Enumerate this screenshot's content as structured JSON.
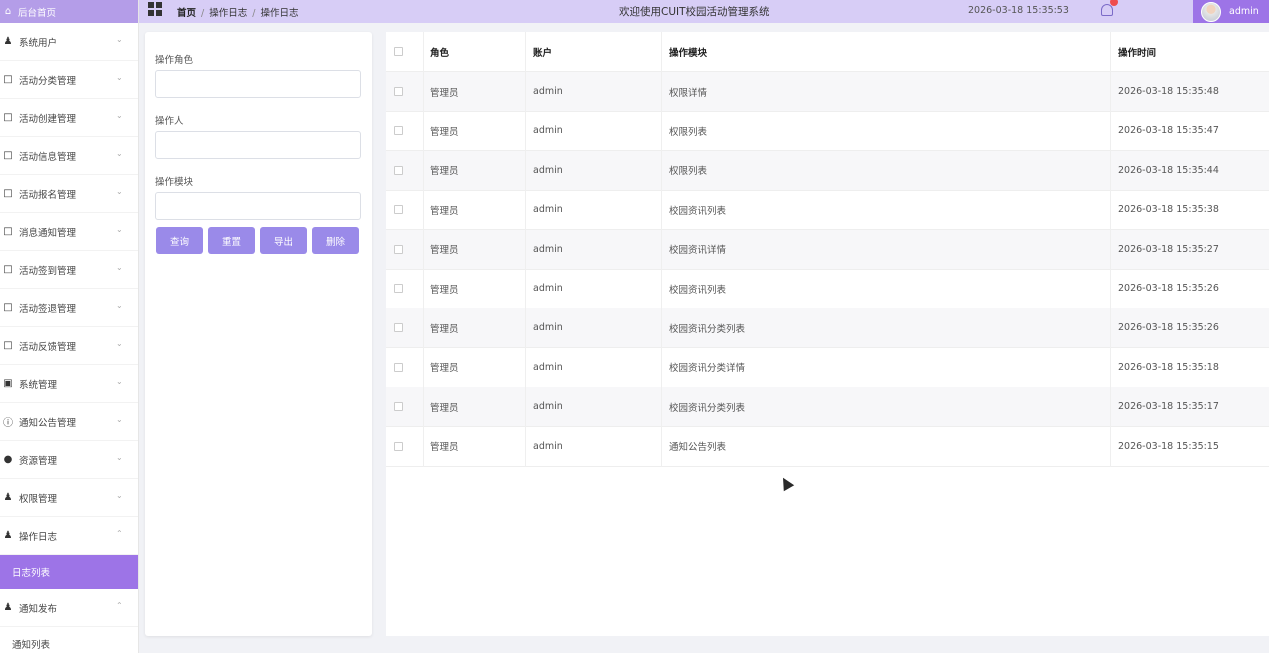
{
  "sidebar": {
    "home_label": "后台首页",
    "items": [
      {
        "label": "系统用户",
        "icon": "user-icon",
        "expanded": false
      },
      {
        "label": "活动分类管理",
        "icon": "tag-icon",
        "expanded": false
      },
      {
        "label": "活动创建管理",
        "icon": "tag-icon",
        "expanded": false
      },
      {
        "label": "活动信息管理",
        "icon": "tag-icon",
        "expanded": false
      },
      {
        "label": "活动报名管理",
        "icon": "tag-icon",
        "expanded": false
      },
      {
        "label": "消息通知管理",
        "icon": "tag-icon",
        "expanded": false
      },
      {
        "label": "活动签到管理",
        "icon": "tag-icon",
        "expanded": false
      },
      {
        "label": "活动签退管理",
        "icon": "tag-icon",
        "expanded": false
      },
      {
        "label": "活动反馈管理",
        "icon": "tag-icon",
        "expanded": false
      },
      {
        "label": "系统管理",
        "icon": "picture-icon",
        "expanded": false
      },
      {
        "label": "通知公告管理",
        "icon": "info-icon",
        "expanded": false
      },
      {
        "label": "资源管理",
        "icon": "pin-icon",
        "expanded": false
      },
      {
        "label": "权限管理",
        "icon": "user-icon",
        "expanded": false
      },
      {
        "label": "操作日志",
        "icon": "user-icon",
        "expanded": true
      },
      {
        "label": "通知发布",
        "icon": "user-icon",
        "expanded": true
      }
    ],
    "sub_log_list": "日志列表",
    "sub_notice_list": "通知列表"
  },
  "topbar": {
    "breadcrumb": [
      "首页",
      "操作日志",
      "操作日志"
    ],
    "welcome": "欢迎使用CUIT校园活动管理系统",
    "datetime": "2026-03-18 15:35:53",
    "username": "admin"
  },
  "search": {
    "role_label": "操作角色",
    "role_value": "",
    "operator_label": "操作人",
    "operator_value": "",
    "module_label": "操作模块",
    "module_value": "",
    "buttons": {
      "query": "查询",
      "reset": "重置",
      "export": "导出",
      "delete": "删除"
    }
  },
  "table": {
    "headers": {
      "role": "角色",
      "account": "账户",
      "module": "操作模块",
      "time": "操作时间"
    },
    "rows": [
      {
        "role": "管理员",
        "account": "admin",
        "module": "权限详情",
        "time": "2026-03-18 15:35:48"
      },
      {
        "role": "管理员",
        "account": "admin",
        "module": "权限列表",
        "time": "2026-03-18 15:35:47"
      },
      {
        "role": "管理员",
        "account": "admin",
        "module": "权限列表",
        "time": "2026-03-18 15:35:44"
      },
      {
        "role": "管理员",
        "account": "admin",
        "module": "校园资讯列表",
        "time": "2026-03-18 15:35:38"
      },
      {
        "role": "管理员",
        "account": "admin",
        "module": "校园资讯详情",
        "time": "2026-03-18 15:35:27"
      },
      {
        "role": "管理员",
        "account": "admin",
        "module": "校园资讯列表",
        "time": "2026-03-18 15:35:26"
      },
      {
        "role": "管理员",
        "account": "admin",
        "module": "校园资讯分类列表",
        "time": "2026-03-18 15:35:26"
      },
      {
        "role": "管理员",
        "account": "admin",
        "module": "校园资讯分类详情",
        "time": "2026-03-18 15:35:18"
      },
      {
        "role": "管理员",
        "account": "admin",
        "module": "校园资讯分类列表",
        "time": "2026-03-18 15:35:17"
      },
      {
        "role": "管理员",
        "account": "admin",
        "module": "通知公告列表",
        "time": "2026-03-18 15:35:15"
      }
    ]
  },
  "colors": {
    "accent": "#9d74e7",
    "topbar": "#d7cdf6",
    "button": "#9a8ae9"
  }
}
